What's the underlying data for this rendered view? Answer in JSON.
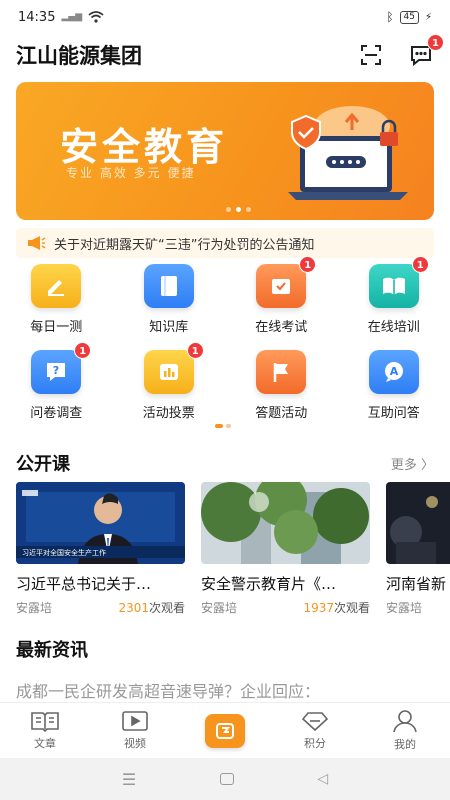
{
  "status": {
    "time": "14:35",
    "signal": "5G",
    "battery": "45"
  },
  "header": {
    "title": "江山能源集团",
    "message_badge": "1"
  },
  "banner": {
    "title": "安全教育",
    "subtitle": "专业 高效 多元 便捷"
  },
  "notice": {
    "text": "关于对近期露天矿“三违”行为处罚的公告通知"
  },
  "grid": {
    "items": [
      {
        "label": "每日一测",
        "badge": ""
      },
      {
        "label": "知识库",
        "badge": ""
      },
      {
        "label": "在线考试",
        "badge": "1"
      },
      {
        "label": "在线培训",
        "badge": "1"
      },
      {
        "label": "问卷调查",
        "badge": "1"
      },
      {
        "label": "活动投票",
        "badge": "1"
      },
      {
        "label": "答题活动",
        "badge": ""
      },
      {
        "label": "互助问答",
        "badge": ""
      }
    ]
  },
  "open_course": {
    "title": "公开课",
    "more": "更多",
    "views_suffix": "次观看",
    "items": [
      {
        "title": "习近平总书记关于…",
        "author": "安露培",
        "views": "2301"
      },
      {
        "title": "安全警示教育片《…",
        "author": "安露培",
        "views": "1937"
      },
      {
        "title": "河南省新",
        "author": "安露培",
        "views": ""
      }
    ],
    "thumb_caption": "习近平对全国安全生产工作"
  },
  "news": {
    "title": "最新资讯",
    "first_headline": "成都一民企研发高超音速导弹？企业回应："
  },
  "tabbar": {
    "items": [
      {
        "label": "文章",
        "icon": "article-icon"
      },
      {
        "label": "视频",
        "icon": "video-icon"
      },
      {
        "label": "",
        "icon": "home-center-icon"
      },
      {
        "label": "积分",
        "icon": "points-icon"
      },
      {
        "label": "我的",
        "icon": "profile-icon"
      }
    ]
  },
  "colors": {
    "accent": "#f7941d",
    "badge": "#f0393b"
  }
}
